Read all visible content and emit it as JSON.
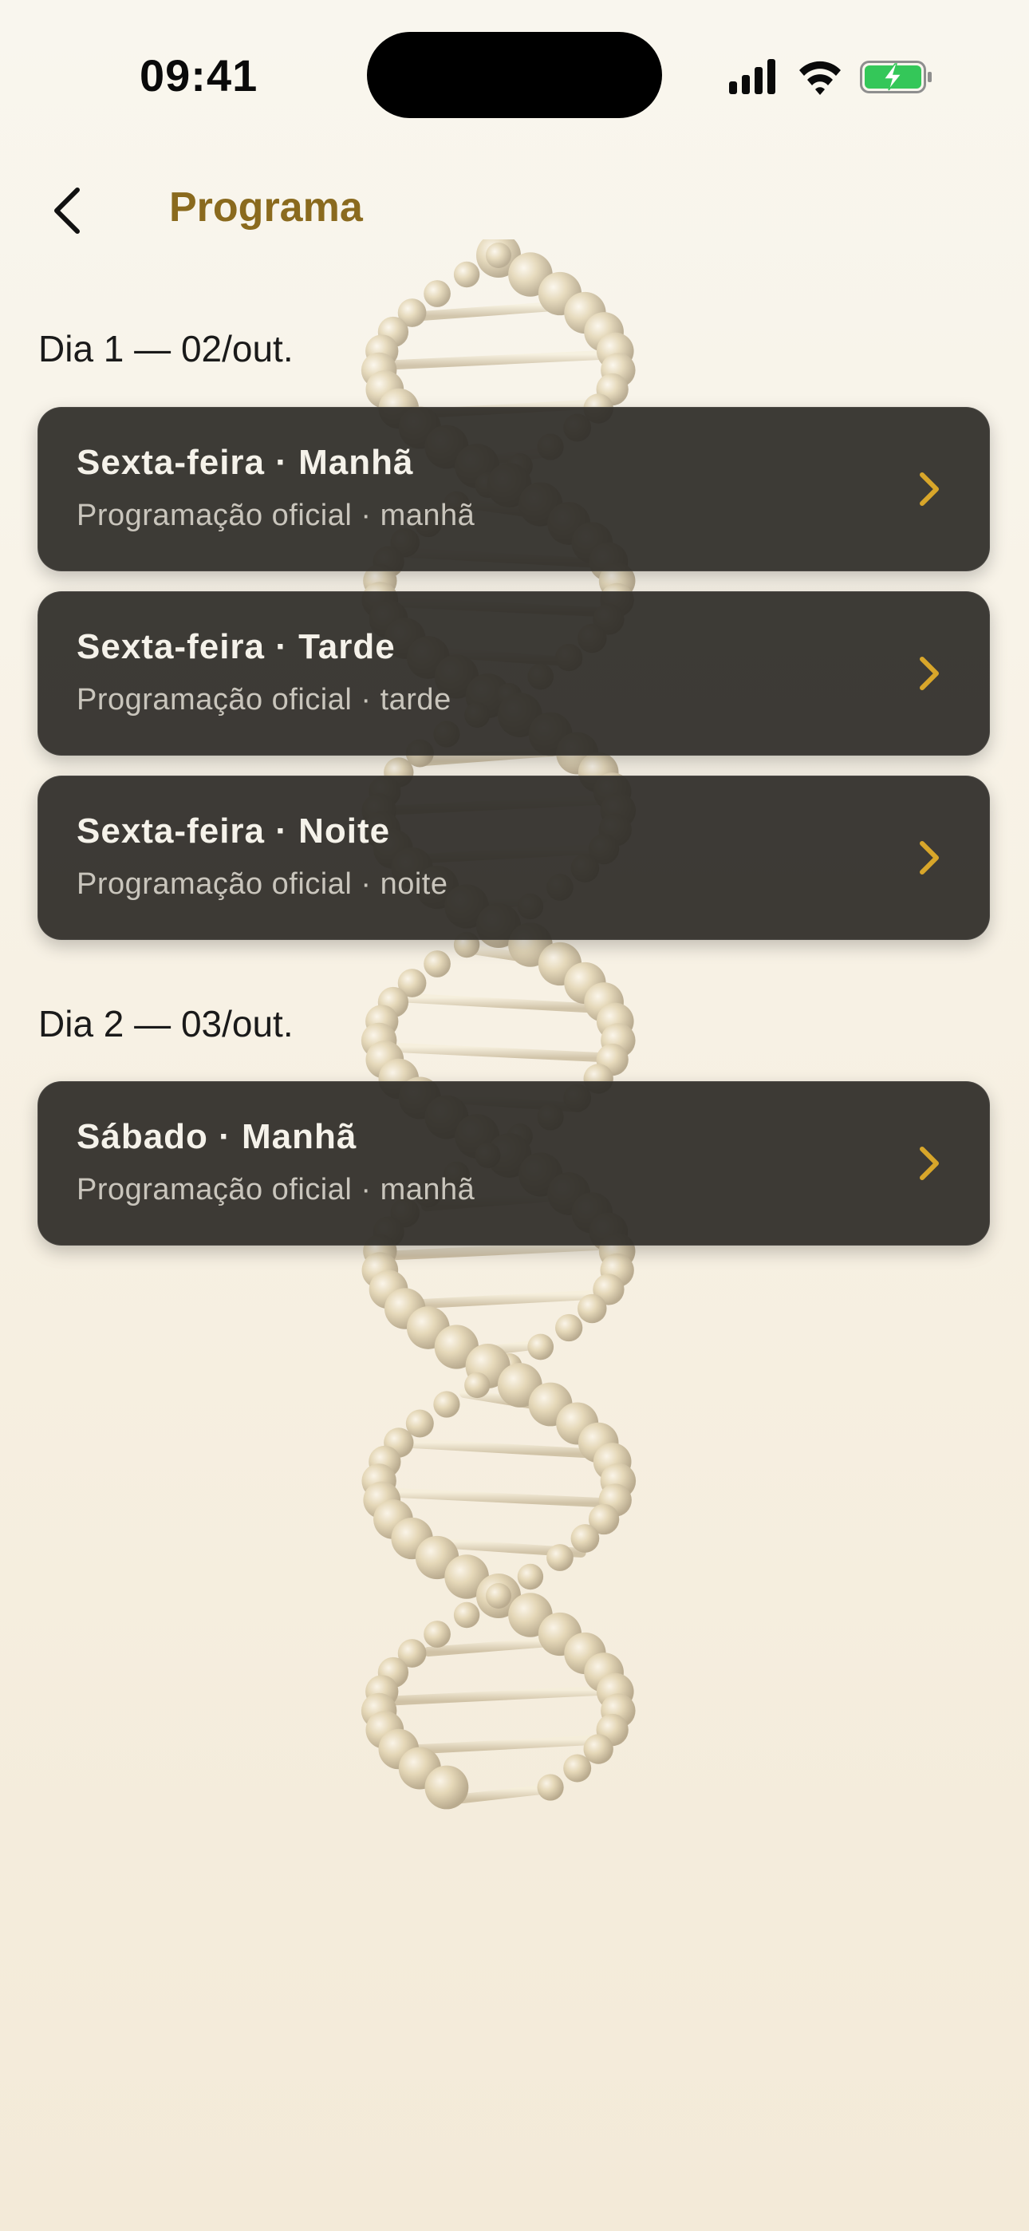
{
  "status_bar": {
    "time": "09:41",
    "icons": [
      "signal-icon",
      "wifi-icon",
      "battery-charging-icon"
    ]
  },
  "header": {
    "back_icon": "chevron-left-icon",
    "title": "Programa"
  },
  "colors": {
    "title": "#8a6a1e",
    "chevron": "#d8a62a",
    "card_bg": "#2e2c28",
    "battery": "#34c759"
  },
  "days": [
    {
      "label": "Dia 1 — 02/out.",
      "sessions": [
        {
          "title": "Sexta-feira · Manhã",
          "subtitle": "Programação oficial · manhã"
        },
        {
          "title": "Sexta-feira · Tarde",
          "subtitle": "Programação oficial · tarde"
        },
        {
          "title": "Sexta-feira · Noite",
          "subtitle": "Programação oficial · noite"
        }
      ]
    },
    {
      "label": "Dia 2 — 03/out.",
      "sessions": [
        {
          "title": "Sábado · Manhã",
          "subtitle": "Programação oficial · manhã"
        }
      ]
    }
  ]
}
